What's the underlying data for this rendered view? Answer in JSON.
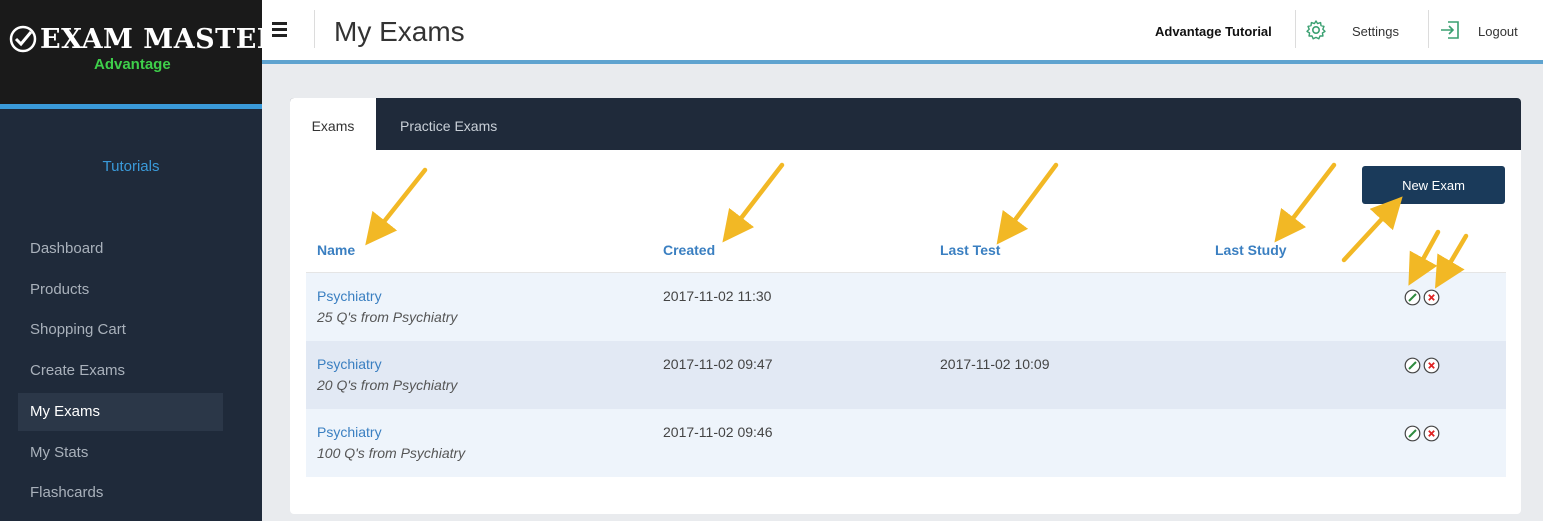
{
  "logo": {
    "name": "Exam Master",
    "name_display": "EXAM MASTER",
    "reg": "®",
    "sub": "Advantage"
  },
  "sidebar": {
    "tutorials_label": "Tutorials",
    "items": [
      {
        "label": "Dashboard"
      },
      {
        "label": "Products"
      },
      {
        "label": "Shopping Cart"
      },
      {
        "label": "Create Exams"
      },
      {
        "label": "My Exams",
        "active": true
      },
      {
        "label": "My Stats"
      },
      {
        "label": "Flashcards"
      }
    ]
  },
  "header": {
    "title": "My Exams",
    "user": "Advantage Tutorial",
    "settings_label": "Settings",
    "logout_label": "Logout",
    "icons": [
      "menu-icon",
      "gear-icon",
      "logout-icon"
    ]
  },
  "tabs": [
    {
      "label": "Exams",
      "active": true
    },
    {
      "label": "Practice Exams"
    }
  ],
  "new_exam_label": "New Exam",
  "table": {
    "columns": [
      "Name",
      "Created",
      "Last Test",
      "Last Study"
    ],
    "rows": [
      {
        "name": "Psychiatry",
        "desc": "25 Q's from Psychiatry",
        "created": "2017-11-02 11:30",
        "last_test": "",
        "last_study": ""
      },
      {
        "name": "Psychiatry",
        "desc": "20 Q's from Psychiatry",
        "created": "2017-11-02 09:47",
        "last_test": "2017-11-02 10:09",
        "last_study": ""
      },
      {
        "name": "Psychiatry",
        "desc": "100 Q's from Psychiatry",
        "created": "2017-11-02 09:46",
        "last_test": "",
        "last_study": ""
      }
    ]
  },
  "colors": {
    "sidebar_bg": "#1f2a3a",
    "accent_blue": "#3a9ad9",
    "link_blue": "#3a7fc1",
    "button_bg": "#1a3a5a",
    "arrow": "#f2b825",
    "edit_icon": "#2e8b3e",
    "delete_icon": "#e02424"
  }
}
